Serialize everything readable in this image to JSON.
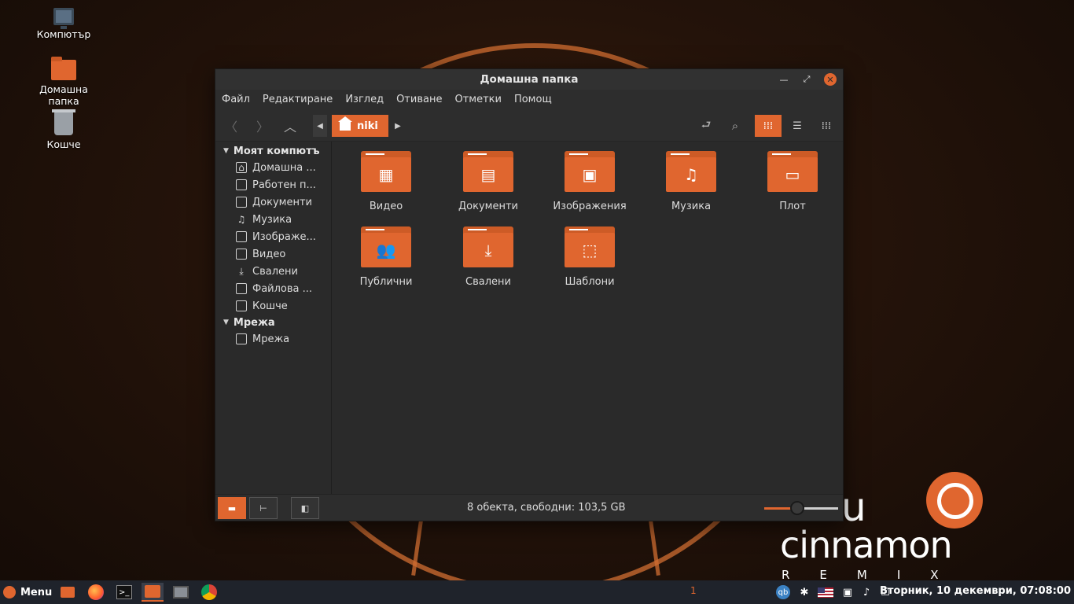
{
  "desktop": {
    "icons": [
      {
        "label": "Компютър",
        "icon": "computer-icon"
      },
      {
        "label": "Домашна папка",
        "icon": "home-folder-icon"
      },
      {
        "label": "Кошче",
        "icon": "trash-icon"
      }
    ],
    "branding": {
      "word1": "untu",
      "word2": "cinnamon",
      "word3": "REMIX"
    }
  },
  "window": {
    "title": "Домашна папка",
    "menu": [
      "Файл",
      "Редактиране",
      "Изглед",
      "Отиване",
      "Отметки",
      "Помощ"
    ],
    "breadcrumb": {
      "current": "niki",
      "icon": "home-icon"
    },
    "sidebar": {
      "sections": [
        {
          "header": "Моят компютъ",
          "items": [
            {
              "label": "Домашна ...",
              "icon": "home-icon"
            },
            {
              "label": "Работен п...",
              "icon": "desktop-icon"
            },
            {
              "label": "Документи",
              "icon": "documents-icon"
            },
            {
              "label": "Музика",
              "icon": "music-icon"
            },
            {
              "label": "Изображе...",
              "icon": "pictures-icon"
            },
            {
              "label": "Видео",
              "icon": "video-icon"
            },
            {
              "label": "Свалени",
              "icon": "downloads-icon"
            },
            {
              "label": "Файлова ...",
              "icon": "filesystem-icon"
            },
            {
              "label": "Кошче",
              "icon": "trash-icon"
            }
          ]
        },
        {
          "header": "Мрежа",
          "items": [
            {
              "label": "Мрежа",
              "icon": "network-icon"
            }
          ]
        }
      ]
    },
    "folders": [
      {
        "label": "Видео",
        "icon": "video-icon"
      },
      {
        "label": "Документи",
        "icon": "document-icon"
      },
      {
        "label": "Изображения",
        "icon": "image-icon"
      },
      {
        "label": "Музика",
        "icon": "music-icon"
      },
      {
        "label": "Плот",
        "icon": "desktop-icon"
      },
      {
        "label": "Публични",
        "icon": "people-icon"
      },
      {
        "label": "Свалени",
        "icon": "download-icon"
      },
      {
        "label": "Шаблони",
        "icon": "template-icon"
      }
    ],
    "status": "8 обекта, свободни: 103,5 GB",
    "zoom_level": 0.45
  },
  "taskbar": {
    "menu_label": "Menu",
    "workspace": "1",
    "clock": "Вторник, 10 декември, 07:08:00",
    "tray": [
      "qbittorrent-icon",
      "bluetooth-icon",
      "us-flag-icon",
      "removable-drive-icon",
      "sound-icon",
      "update-ok-icon"
    ]
  },
  "colors": {
    "accent": "#e0662f",
    "window_bg": "#2d2d2d",
    "panel_bg": "#1f232b"
  }
}
